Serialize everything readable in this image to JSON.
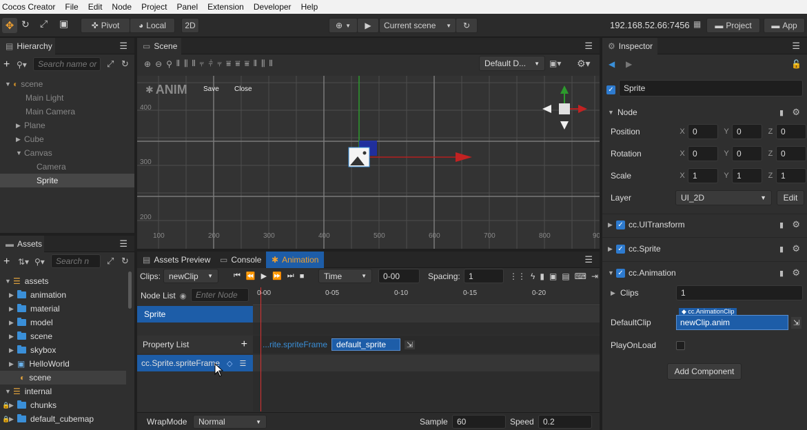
{
  "menubar": [
    "Cocos Creator",
    "File",
    "Edit",
    "Node",
    "Project",
    "Panel",
    "Extension",
    "Developer",
    "Help"
  ],
  "toolbar": {
    "pivot": "Pivot",
    "local": "Local",
    "mode_2d": "2D",
    "scene_select": "Current scene",
    "ip": "192.168.52.66:7456",
    "project_btn": "Project",
    "app_btn": "App"
  },
  "hierarchy": {
    "tab": "Hierarchy",
    "search_placeholder": "Search name or",
    "items": [
      {
        "label": "scene"
      },
      {
        "label": "Main Light"
      },
      {
        "label": "Main Camera"
      },
      {
        "label": "Plane"
      },
      {
        "label": "Cube"
      },
      {
        "label": "Canvas"
      },
      {
        "label": "Camera"
      },
      {
        "label": "Sprite"
      }
    ]
  },
  "assets": {
    "tab": "Assets",
    "search_placeholder": "Search n",
    "items": [
      {
        "label": "assets"
      },
      {
        "label": "animation"
      },
      {
        "label": "material"
      },
      {
        "label": "model"
      },
      {
        "label": "scene"
      },
      {
        "label": "skybox"
      },
      {
        "label": "HelloWorld"
      },
      {
        "label": "scene"
      },
      {
        "label": "internal"
      },
      {
        "label": "chunks"
      },
      {
        "label": "default_cubemap"
      }
    ]
  },
  "scene": {
    "tab": "Scene",
    "view_select": "Default D...",
    "anim_label": "ANIM",
    "save": "Save",
    "close": "Close",
    "y_ticks": [
      "400",
      "300",
      "200"
    ],
    "x_ticks": [
      "100",
      "200",
      "300",
      "400",
      "500",
      "600",
      "700",
      "800",
      "90"
    ]
  },
  "bottom": {
    "tabs": [
      "Assets Preview",
      "Console",
      "Animation"
    ],
    "clips_label": "Clips:",
    "clip_value": "newClip",
    "time_select": "Time",
    "time_value": "0-00",
    "spacing_label": "Spacing:",
    "spacing_value": "1",
    "node_list": "Node List",
    "node_placeholder": "Enter Node",
    "timeline_ticks": [
      "0-00",
      "0-05",
      "0-10",
      "0-15",
      "0-20"
    ],
    "node_item": "Sprite",
    "property_list": "Property List",
    "property_path": "...rite.spriteFrame",
    "property_value": "default_sprite",
    "property_item": "cc.Sprite.spriteFrame",
    "wrapmode_label": "WrapMode",
    "wrapmode_value": "Normal",
    "sample_label": "Sample",
    "sample_value": "60",
    "speed_label": "Speed",
    "speed_value": "0.2"
  },
  "inspector": {
    "tab": "Inspector",
    "node_name": "Sprite",
    "node_section": "Node",
    "position_label": "Position",
    "position": [
      "0",
      "0",
      "0"
    ],
    "rotation_label": "Rotation",
    "rotation": [
      "0",
      "0",
      "0"
    ],
    "scale_label": "Scale",
    "scale": [
      "1",
      "1",
      "1"
    ],
    "axes": [
      "X",
      "Y",
      "Z"
    ],
    "layer_label": "Layer",
    "layer_value": "UI_2D",
    "edit_btn": "Edit",
    "components": [
      "cc.UITransform",
      "cc.Sprite",
      "cc.Animation"
    ],
    "clips_label": "Clips",
    "clips_value": "1",
    "defaultclip_label": "DefaultClip",
    "defaultclip_tag": "cc.AnimationClip",
    "defaultclip_value": "newClip.anim",
    "playonload_label": "PlayOnLoad",
    "add_component": "Add Component"
  }
}
